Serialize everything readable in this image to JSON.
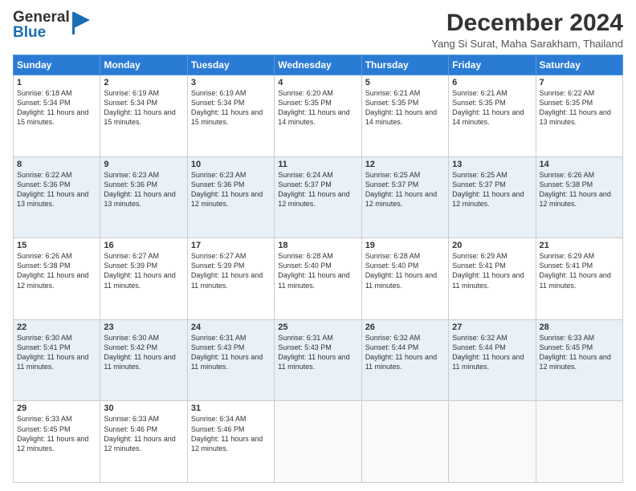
{
  "header": {
    "logo_line1": "General",
    "logo_line2": "Blue",
    "title": "December 2024",
    "subtitle": "Yang Si Surat, Maha Sarakham, Thailand"
  },
  "weekdays": [
    "Sunday",
    "Monday",
    "Tuesday",
    "Wednesday",
    "Thursday",
    "Friday",
    "Saturday"
  ],
  "weeks": [
    [
      {
        "day": "1",
        "sunrise": "6:18 AM",
        "sunset": "5:34 PM",
        "daylight": "11 hours and 15 minutes."
      },
      {
        "day": "2",
        "sunrise": "6:19 AM",
        "sunset": "5:34 PM",
        "daylight": "11 hours and 15 minutes."
      },
      {
        "day": "3",
        "sunrise": "6:19 AM",
        "sunset": "5:34 PM",
        "daylight": "11 hours and 15 minutes."
      },
      {
        "day": "4",
        "sunrise": "6:20 AM",
        "sunset": "5:35 PM",
        "daylight": "11 hours and 14 minutes."
      },
      {
        "day": "5",
        "sunrise": "6:21 AM",
        "sunset": "5:35 PM",
        "daylight": "11 hours and 14 minutes."
      },
      {
        "day": "6",
        "sunrise": "6:21 AM",
        "sunset": "5:35 PM",
        "daylight": "11 hours and 14 minutes."
      },
      {
        "day": "7",
        "sunrise": "6:22 AM",
        "sunset": "5:35 PM",
        "daylight": "11 hours and 13 minutes."
      }
    ],
    [
      {
        "day": "8",
        "sunrise": "6:22 AM",
        "sunset": "5:36 PM",
        "daylight": "11 hours and 13 minutes."
      },
      {
        "day": "9",
        "sunrise": "6:23 AM",
        "sunset": "5:36 PM",
        "daylight": "11 hours and 13 minutes."
      },
      {
        "day": "10",
        "sunrise": "6:23 AM",
        "sunset": "5:36 PM",
        "daylight": "11 hours and 12 minutes."
      },
      {
        "day": "11",
        "sunrise": "6:24 AM",
        "sunset": "5:37 PM",
        "daylight": "11 hours and 12 minutes."
      },
      {
        "day": "12",
        "sunrise": "6:25 AM",
        "sunset": "5:37 PM",
        "daylight": "11 hours and 12 minutes."
      },
      {
        "day": "13",
        "sunrise": "6:25 AM",
        "sunset": "5:37 PM",
        "daylight": "11 hours and 12 minutes."
      },
      {
        "day": "14",
        "sunrise": "6:26 AM",
        "sunset": "5:38 PM",
        "daylight": "11 hours and 12 minutes."
      }
    ],
    [
      {
        "day": "15",
        "sunrise": "6:26 AM",
        "sunset": "5:38 PM",
        "daylight": "11 hours and 12 minutes."
      },
      {
        "day": "16",
        "sunrise": "6:27 AM",
        "sunset": "5:39 PM",
        "daylight": "11 hours and 11 minutes."
      },
      {
        "day": "17",
        "sunrise": "6:27 AM",
        "sunset": "5:39 PM",
        "daylight": "11 hours and 11 minutes."
      },
      {
        "day": "18",
        "sunrise": "6:28 AM",
        "sunset": "5:40 PM",
        "daylight": "11 hours and 11 minutes."
      },
      {
        "day": "19",
        "sunrise": "6:28 AM",
        "sunset": "5:40 PM",
        "daylight": "11 hours and 11 minutes."
      },
      {
        "day": "20",
        "sunrise": "6:29 AM",
        "sunset": "5:41 PM",
        "daylight": "11 hours and 11 minutes."
      },
      {
        "day": "21",
        "sunrise": "6:29 AM",
        "sunset": "5:41 PM",
        "daylight": "11 hours and 11 minutes."
      }
    ],
    [
      {
        "day": "22",
        "sunrise": "6:30 AM",
        "sunset": "5:41 PM",
        "daylight": "11 hours and 11 minutes."
      },
      {
        "day": "23",
        "sunrise": "6:30 AM",
        "sunset": "5:42 PM",
        "daylight": "11 hours and 11 minutes."
      },
      {
        "day": "24",
        "sunrise": "6:31 AM",
        "sunset": "5:43 PM",
        "daylight": "11 hours and 11 minutes."
      },
      {
        "day": "25",
        "sunrise": "6:31 AM",
        "sunset": "5:43 PM",
        "daylight": "11 hours and 11 minutes."
      },
      {
        "day": "26",
        "sunrise": "6:32 AM",
        "sunset": "5:44 PM",
        "daylight": "11 hours and 11 minutes."
      },
      {
        "day": "27",
        "sunrise": "6:32 AM",
        "sunset": "5:44 PM",
        "daylight": "11 hours and 11 minutes."
      },
      {
        "day": "28",
        "sunrise": "6:33 AM",
        "sunset": "5:45 PM",
        "daylight": "11 hours and 12 minutes."
      }
    ],
    [
      {
        "day": "29",
        "sunrise": "6:33 AM",
        "sunset": "5:45 PM",
        "daylight": "11 hours and 12 minutes."
      },
      {
        "day": "30",
        "sunrise": "6:33 AM",
        "sunset": "5:46 PM",
        "daylight": "11 hours and 12 minutes."
      },
      {
        "day": "31",
        "sunrise": "6:34 AM",
        "sunset": "5:46 PM",
        "daylight": "11 hours and 12 minutes."
      },
      null,
      null,
      null,
      null
    ]
  ],
  "labels": {
    "sunrise": "Sunrise:",
    "sunset": "Sunset:",
    "daylight": "Daylight:"
  },
  "colors": {
    "header_bg": "#2a7bd4",
    "row_even": "#e8f0f8",
    "row_odd": "#ffffff"
  }
}
